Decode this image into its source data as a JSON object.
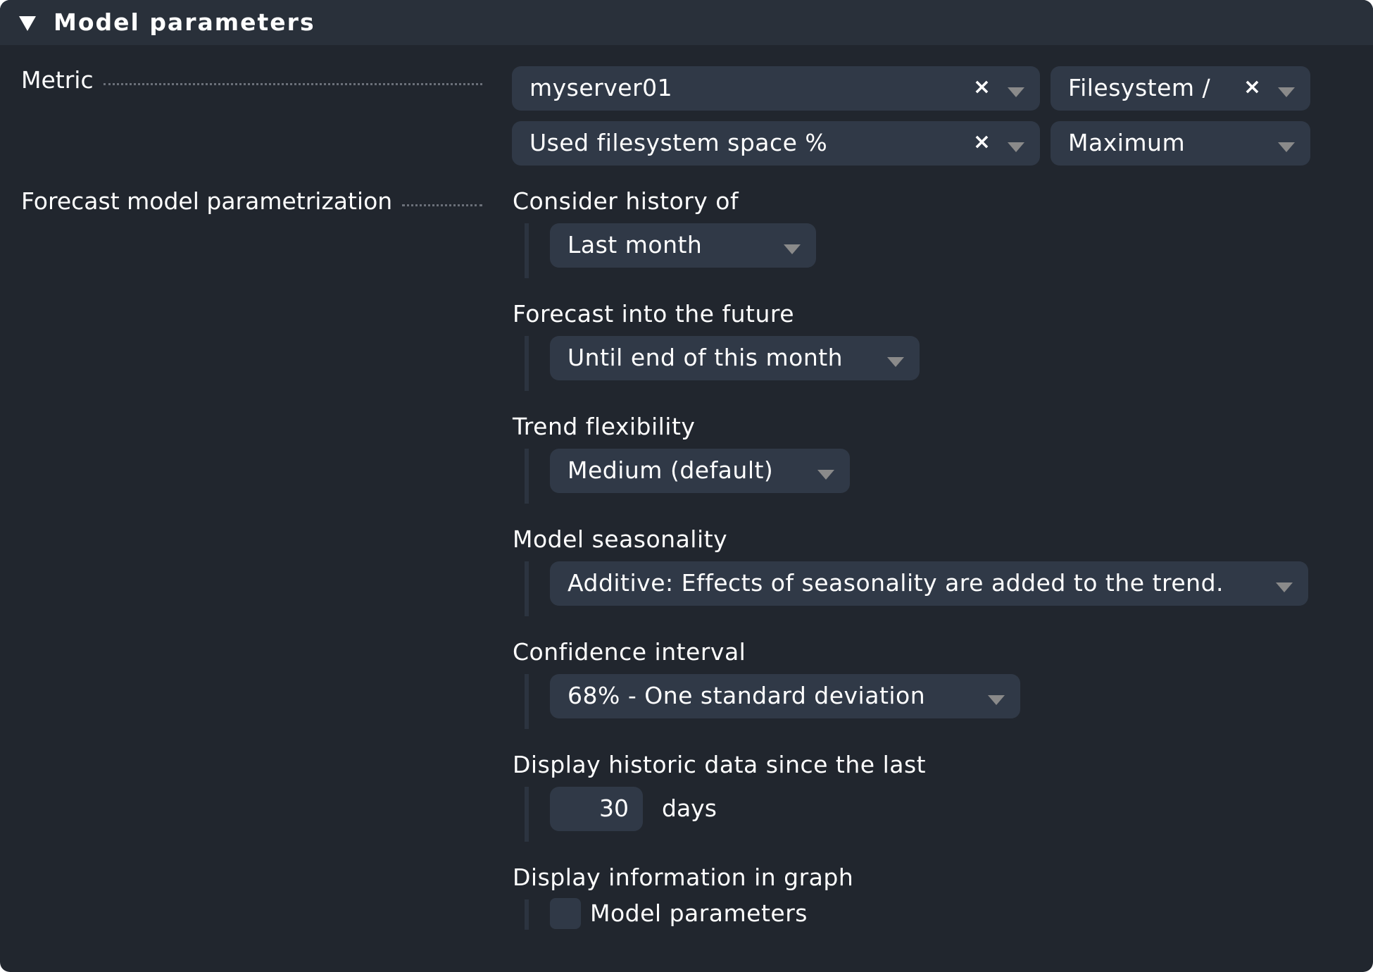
{
  "header": {
    "title": "Model parameters",
    "toggle_icon": "triangle-down"
  },
  "metric": {
    "legend": "Metric",
    "host": {
      "value": "myserver01",
      "clear": "×"
    },
    "service": {
      "value": "Filesystem /",
      "clear": "×"
    },
    "metric_name": {
      "value": "Used filesystem space %",
      "clear": "×"
    },
    "consolidation": {
      "value": "Maximum"
    }
  },
  "forecast": {
    "legend": "Forecast model parametrization",
    "history": {
      "label": "Consider history of",
      "value": "Last month"
    },
    "future": {
      "label": "Forecast into the future",
      "value": "Until end of this month"
    },
    "trend": {
      "label": "Trend flexibility",
      "value": "Medium (default)"
    },
    "seasonality": {
      "label": "Model seasonality",
      "value": "Additive: Effects of seasonality are added to the trend."
    },
    "confidence": {
      "label": "Confidence interval",
      "value": "68% - One standard deviation"
    },
    "historic": {
      "label": "Display historic data since the last",
      "value": "30",
      "unit": "days"
    },
    "display_info": {
      "label": "Display information in graph",
      "checkbox_label": "Model parameters",
      "checked": false
    }
  }
}
